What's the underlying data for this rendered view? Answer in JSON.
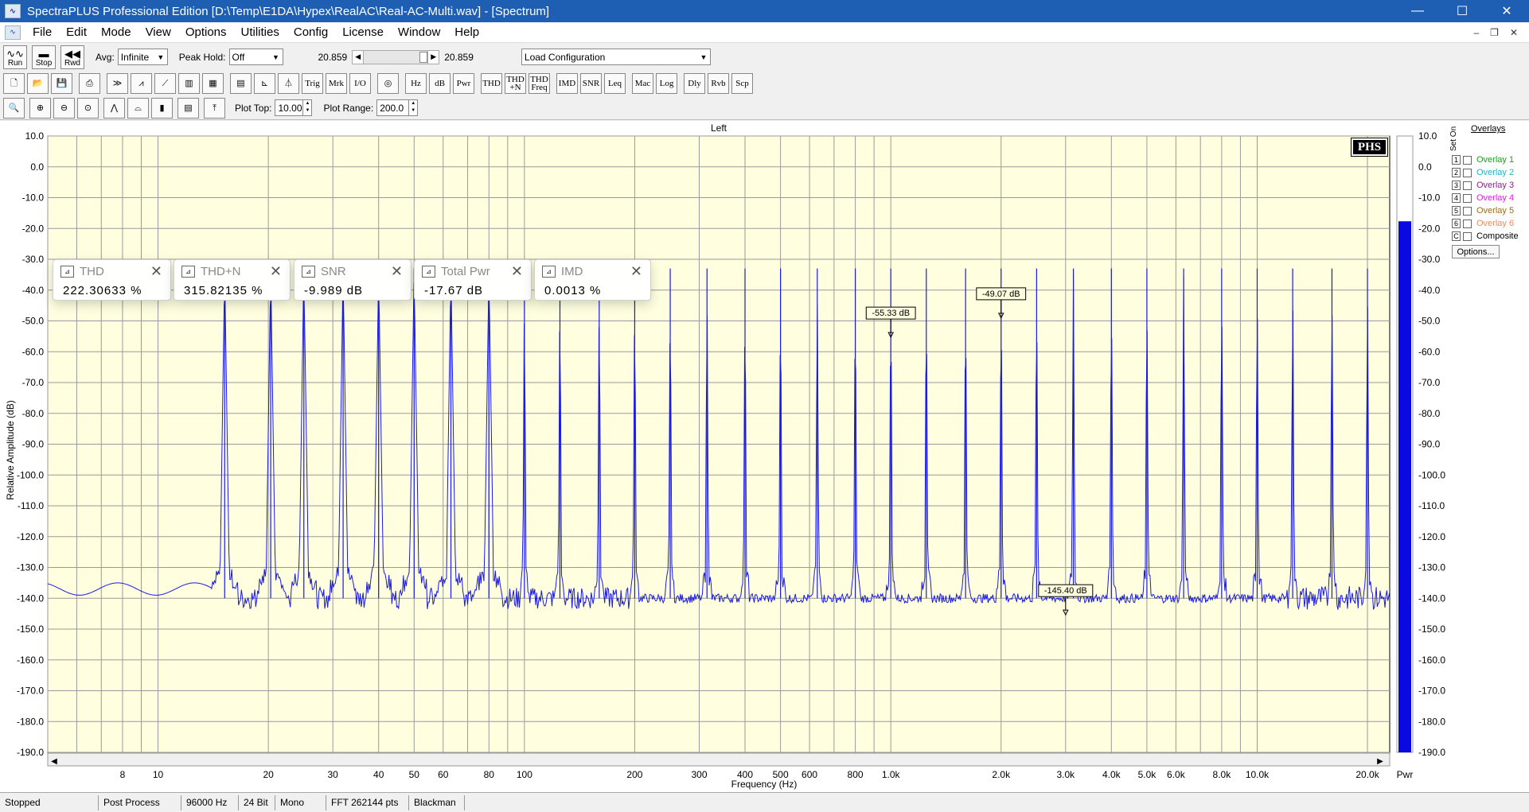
{
  "window": {
    "title": "SpectraPLUS Professional Edition [D:\\Temp\\E1DA\\Hypex\\RealAC\\Real-AC-Multi.wav] - [Spectrum]",
    "app_icon": "spectrum-app-icon",
    "minimize_glyph": "—",
    "maximize_glyph": "☐",
    "close_glyph": "✕"
  },
  "menu": {
    "items": [
      "File",
      "Edit",
      "Mode",
      "View",
      "Options",
      "Utilities",
      "Config",
      "License",
      "Window",
      "Help"
    ],
    "mdi_minimize": "–",
    "mdi_restore": "❐",
    "mdi_close": "✕"
  },
  "toolbar1": {
    "run_label": "Run",
    "stop_label": "Stop",
    "rwd_label": "Rwd",
    "avg_label": "Avg:",
    "avg_value": "Infinite",
    "peak_hold_label": "Peak Hold:",
    "peak_hold_value": "Off",
    "time_left": "20.859",
    "time_right": "20.859",
    "config_value": "Load Configuration"
  },
  "toolbar2": {
    "buttons": [
      "Trig",
      "Mrk",
      "I/O",
      "Hz",
      "dB",
      "Pwr",
      "THD",
      "THD +N",
      "THD Freq",
      "IMD",
      "SNR",
      "Leq",
      "Mac",
      "Log",
      "Dly",
      "Rvb",
      "Scp"
    ]
  },
  "toolbar3": {
    "plot_top_label": "Plot Top:",
    "plot_top_value": "10.00",
    "plot_range_label": "Plot Range:",
    "plot_range_value": "200.0"
  },
  "meters": [
    {
      "name": "THD",
      "value": "222.30633 %"
    },
    {
      "name": "THD+N",
      "value": "315.82135 %"
    },
    {
      "name": "SNR",
      "value": "-9.989 dB"
    },
    {
      "name": "Total Pwr",
      "value": "-17.67 dB"
    },
    {
      "name": "IMD",
      "value": "0.0013 %"
    }
  ],
  "overlays": {
    "header": "Overlays",
    "set_on": "Set On",
    "items": [
      {
        "num": "1",
        "label": "Overlay 1",
        "color": "#1a9f1a"
      },
      {
        "num": "2",
        "label": "Overlay 2",
        "color": "#1fb5c8"
      },
      {
        "num": "3",
        "label": "Overlay 3",
        "color": "#8b2090"
      },
      {
        "num": "4",
        "label": "Overlay 4",
        "color": "#e020e0"
      },
      {
        "num": "5",
        "label": "Overlay 5",
        "color": "#9c6b1a"
      },
      {
        "num": "6",
        "label": "Overlay 6",
        "color": "#f08a5a"
      },
      {
        "num": "C",
        "label": "Composite",
        "color": "#000000"
      }
    ],
    "options_label": "Options..."
  },
  "logo_text": "PHS",
  "status": [
    "Stopped",
    "Post Process",
    "96000 Hz",
    "24 Bit",
    "Mono",
    "FFT 262144 pts",
    "Blackman"
  ],
  "colors": {
    "plot_bg": "#ffffe0",
    "trace": "#1a1ae0",
    "bar": "#0a0ae0",
    "title_bar": "#1f5fb3"
  },
  "chart_data": {
    "type": "line",
    "title": "Left",
    "xlabel": "Frequency (Hz)",
    "ylabel": "Relative Amplitude (dB)",
    "x_scale": "log",
    "xlim": [
      5,
      23000
    ],
    "ylim": [
      -190,
      10
    ],
    "grid": true,
    "y_ticks": [
      10,
      0,
      -10,
      -20,
      -30,
      -40,
      -50,
      -60,
      -70,
      -80,
      -90,
      -100,
      -110,
      -120,
      -130,
      -140,
      -150,
      -160,
      -170,
      -180,
      -190
    ],
    "y_tick_labels": [
      "10.0",
      "0.0",
      "-10.0",
      "-20.0",
      "-30.0",
      "-40.0",
      "-50.0",
      "-60.0",
      "-70.0",
      "-80.0",
      "-90.0",
      "-100.0",
      "-110.0",
      "-120.0",
      "-130.0",
      "-140.0",
      "-150.0",
      "-160.0",
      "-170.0",
      "-180.0",
      "-190.0"
    ],
    "x_ticks": [
      8,
      10,
      20,
      30,
      40,
      50,
      60,
      80,
      100,
      200,
      300,
      400,
      500,
      600,
      800,
      1000,
      2000,
      3000,
      4000,
      5000,
      6000,
      8000,
      10000,
      20000
    ],
    "x_tick_labels": [
      "8",
      "10",
      "20",
      "30",
      "40",
      "50",
      "60",
      "80",
      "100",
      "200",
      "300",
      "400",
      "500",
      "600",
      "800",
      "1.0k",
      "2.0k",
      "3.0k",
      "4.0k",
      "5.0k",
      "6.0k",
      "8.0k",
      "10.0k",
      "20.0k"
    ],
    "noise_floor_db": -140,
    "peaks": [
      {
        "x": 15.2,
        "y": -33
      },
      {
        "x": 20.3,
        "y": -33
      },
      {
        "x": 25.0,
        "y": -33
      },
      {
        "x": 32.0,
        "y": -33
      },
      {
        "x": 40.0,
        "y": -33
      },
      {
        "x": 50.0,
        "y": -33
      },
      {
        "x": 63.0,
        "y": -33
      },
      {
        "x": 80.0,
        "y": -33
      },
      {
        "x": 100,
        "y": -33
      },
      {
        "x": 125,
        "y": -33
      },
      {
        "x": 160,
        "y": -33
      },
      {
        "x": 200,
        "y": -33
      },
      {
        "x": 250,
        "y": -33
      },
      {
        "x": 315,
        "y": -33
      },
      {
        "x": 400,
        "y": -33
      },
      {
        "x": 500,
        "y": -33
      },
      {
        "x": 630,
        "y": -33
      },
      {
        "x": 800,
        "y": -33
      },
      {
        "x": 1000,
        "y": -33
      },
      {
        "x": 1250,
        "y": -33
      },
      {
        "x": 1600,
        "y": -33
      },
      {
        "x": 2000,
        "y": -33
      },
      {
        "x": 2500,
        "y": -33
      },
      {
        "x": 3150,
        "y": -33
      },
      {
        "x": 4000,
        "y": -33
      },
      {
        "x": 5000,
        "y": -33
      },
      {
        "x": 6300,
        "y": -33
      },
      {
        "x": 8000,
        "y": -33
      },
      {
        "x": 10000,
        "y": -33
      },
      {
        "x": 12500,
        "y": -33
      },
      {
        "x": 16000,
        "y": -33
      },
      {
        "x": 20000,
        "y": -33
      }
    ],
    "markers": [
      {
        "x": 1000,
        "y": -55.33,
        "label": "-55.33 dB"
      },
      {
        "x": 2000,
        "y": -49.07,
        "label": "-49.07 dB"
      },
      {
        "x": 3000,
        "y": -145.4,
        "label": "-145.40 dB"
      }
    ],
    "level_bar": {
      "label": "Pwr",
      "value_db": -17.67
    }
  }
}
